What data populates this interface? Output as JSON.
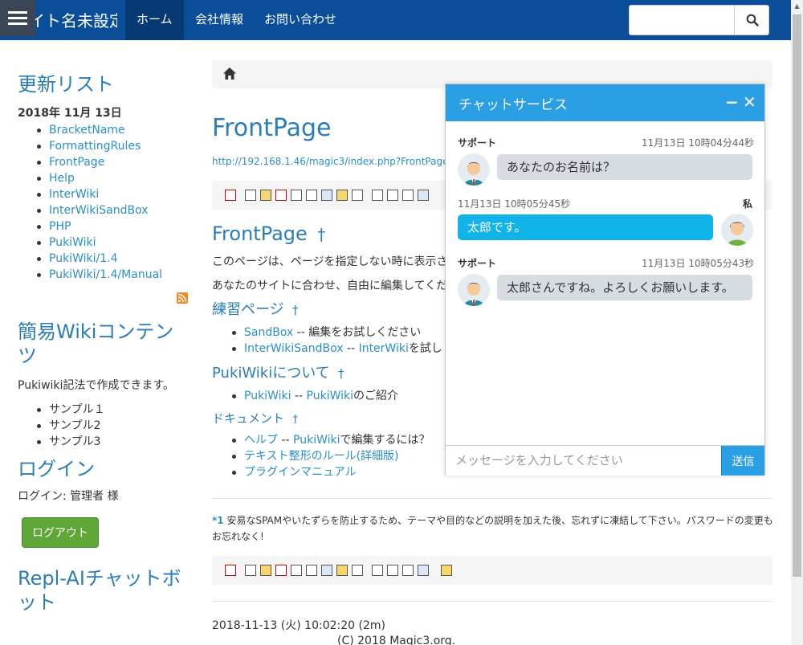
{
  "navbar": {
    "brand": "イト名未設定",
    "items": [
      {
        "label": "ホーム"
      },
      {
        "label": "会社情報"
      },
      {
        "label": "お問い合わせ"
      }
    ]
  },
  "sidebar": {
    "recent_title": "更新リスト",
    "recent_date": "2018年 11月 13日",
    "recent_items": [
      "BracketName",
      "FormattingRules",
      "FrontPage",
      "Help",
      "InterWiki",
      "InterWikiSandBox",
      "PHP",
      "PukiWiki",
      "PukiWiki/1.4",
      "PukiWiki/1.4/Manual"
    ],
    "wiki_title": "簡易Wikiコンテンツ",
    "wiki_desc": "Pukiwiki記法で作成できます。",
    "wiki_items": [
      "サンプル１",
      "サンプル2",
      "サンプル3"
    ],
    "login_title": "ログイン",
    "login_user": "ログイン: 管理者 様",
    "logout_label": "ログアウト",
    "bot_title": "Repl-AIチャットボット"
  },
  "main": {
    "title": "FrontPage",
    "url": "http://192.168.1.46/magic3/index.php?FrontPage",
    "heading": "FrontPage",
    "anchor": "†",
    "para1": "このページは、ページを指定しない時に表示さ",
    "para2": "あなたのサイトに合わせ、自由に編集してくだ",
    "practice_title": "練習ページ",
    "practice_items": [
      {
        "link": "SandBox",
        "sep": " -- ",
        "text": "編集をお試しください"
      },
      {
        "link": "InterWikiSandBox",
        "sep": " -- ",
        "link2": "InterWiki",
        "text": "を試し"
      }
    ],
    "about_title": "PukiWikiについて",
    "about_items": [
      {
        "link": "PukiWiki",
        "sep": " -- ",
        "link2": "PukiWiki",
        "text": "のご紹介"
      }
    ],
    "docs_title": "ドキュメント",
    "docs_items": [
      {
        "link": "ヘルプ",
        "sep": " -- ",
        "link2": "PukiWiki",
        "text": "で編集するには？"
      },
      {
        "link": "テキスト整形のルール(詳細版)"
      },
      {
        "link": "プラグインマニュアル"
      }
    ],
    "footnote_mark": "*1",
    "footnote_text": "安易なSPAMやいたずらを防止するため、テーマや目的などの説明を加えた後、忘れずに凍結して下さい。パスワードの変更もお忘れなく!",
    "timestamp": "2018-11-13 (火) 10:02:20 (2m)",
    "copyright": "(C) 2018 Magic3.org."
  },
  "chat": {
    "title": "チャットサービス",
    "minimize": "−",
    "close": "✕",
    "messages": [
      {
        "who": "サポート",
        "time": "11月13日 10時04分44秒",
        "text": "あなたのお名前は？"
      },
      {
        "who": "私",
        "time": "11月13日 10時05分45秒",
        "text": "太郎です。"
      },
      {
        "who": "サポート",
        "time": "11月13日 10時05分43秒",
        "text": "太郎さんですね。よろしくお願いします。"
      }
    ],
    "input_placeholder": "メッセージを入力してください",
    "send_label": "送信"
  }
}
